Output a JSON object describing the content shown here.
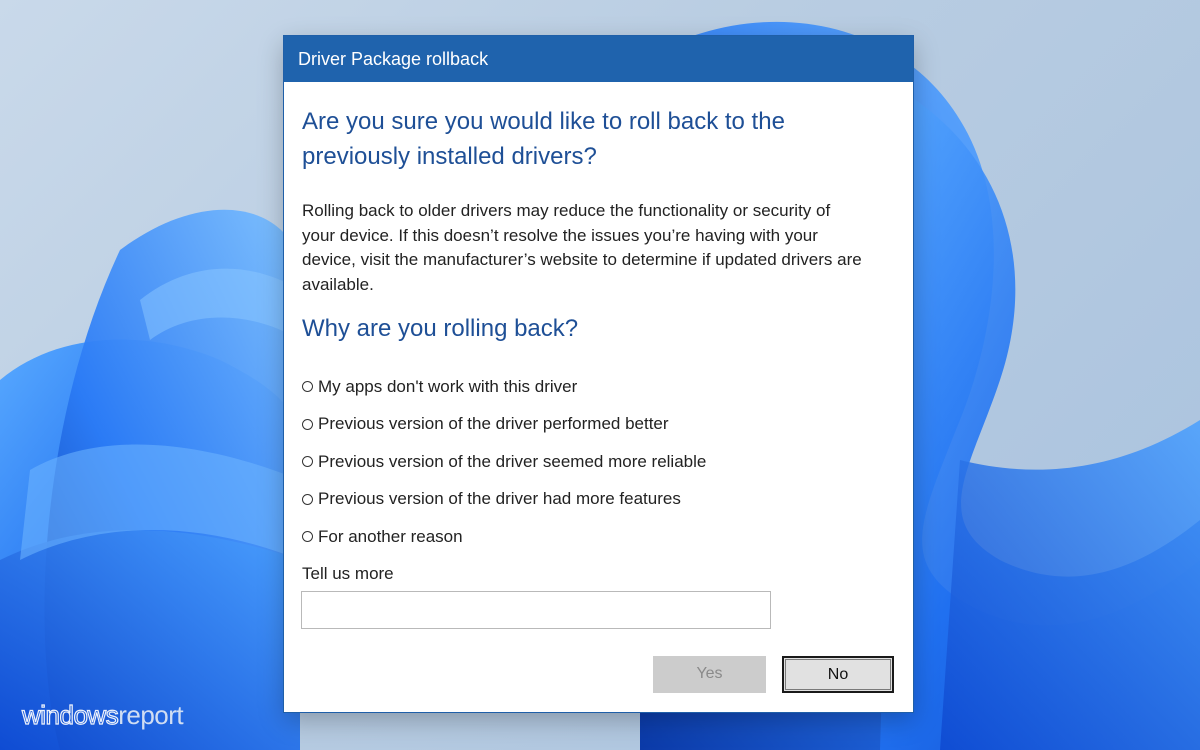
{
  "dialog": {
    "title": "Driver Package rollback",
    "question": "Are you sure you would like to roll back to the previously installed drivers?",
    "description": "Rolling back to older drivers may reduce the functionality or security of your device.  If this doesn’t resolve the issues you’re having with your device, visit the manufacturer’s website to determine if updated drivers are available.",
    "reason_heading": "Why are you rolling back?",
    "options": [
      {
        "label": "My apps don't work with this driver",
        "selected": false
      },
      {
        "label": "Previous version of the driver performed better",
        "selected": false
      },
      {
        "label": "Previous version of the driver seemed more reliable",
        "selected": false
      },
      {
        "label": "Previous version of the driver had more features",
        "selected": false
      },
      {
        "label": "For another reason",
        "selected": false
      }
    ],
    "tell_more_label": "Tell us more",
    "tell_more_value": "",
    "buttons": {
      "yes_label": "Yes",
      "yes_enabled": false,
      "no_label": "No"
    }
  },
  "watermark": {
    "part1": "windows",
    "part2": "report"
  },
  "colors": {
    "titlebar": "#1f63ad",
    "heading": "#1e4f96",
    "wallpaper_blue": "#1a5fe6"
  },
  "icons": {
    "radio": "radio-button-icon"
  }
}
